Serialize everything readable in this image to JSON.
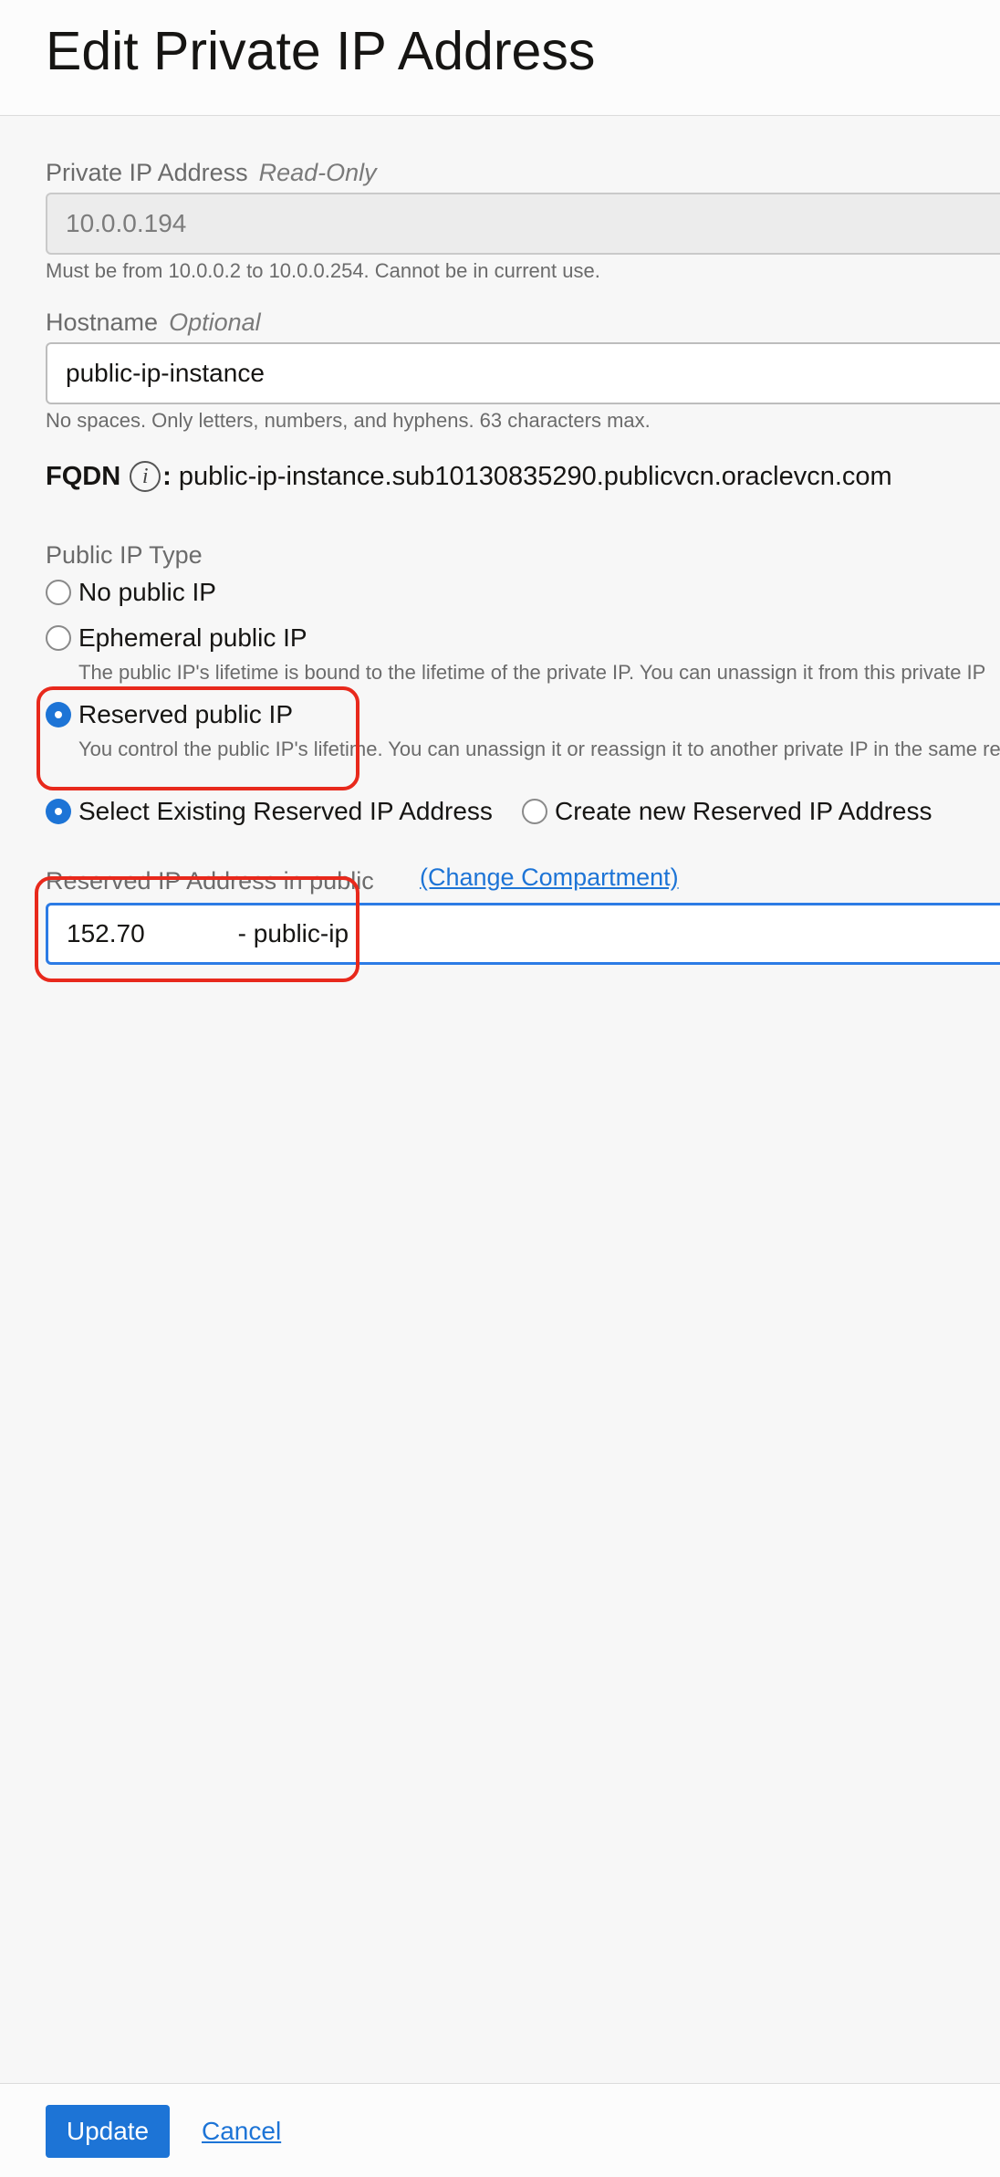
{
  "header": {
    "title": "Edit Private IP Address"
  },
  "private_ip": {
    "label": "Private IP Address",
    "qualifier": "Read-Only",
    "value": "10.0.0.194",
    "help": "Must be from 10.0.0.2 to 10.0.0.254. Cannot be in current use."
  },
  "hostname": {
    "label": "Hostname",
    "qualifier": "Optional",
    "value": "public-ip-instance",
    "help": "No spaces. Only letters, numbers, and hyphens. 63 characters max."
  },
  "fqdn": {
    "label": "FQDN",
    "info_icon": "i",
    "colon": ":",
    "value": "public-ip-instance.sub10130835290.publicvcn.oraclevcn.com"
  },
  "public_ip_type": {
    "label": "Public IP Type",
    "options": [
      {
        "label": "No public IP",
        "checked": false
      },
      {
        "label": "Ephemeral public IP",
        "checked": false,
        "description": "The public IP's lifetime is bound to the lifetime of the private IP. You can unassign it from this private IP"
      },
      {
        "label": "Reserved public IP",
        "checked": true,
        "description": "You control the public IP's lifetime. You can unassign it or reassign it to another private IP in the same re"
      }
    ]
  },
  "reserved_source": {
    "options": [
      {
        "label": "Select Existing Reserved IP Address",
        "checked": true
      },
      {
        "label": "Create new Reserved IP Address",
        "checked": false
      }
    ]
  },
  "reserved_ip": {
    "label": "Reserved IP Address in public",
    "change_link": "(Change Compartment)",
    "value_ip": "152.70",
    "value_name": "- public-ip"
  },
  "footer": {
    "update_label": "Update",
    "cancel_label": "Cancel"
  },
  "colors": {
    "accent": "#1d74d6",
    "highlight": "#e8291c",
    "background": "#f7f7f7"
  }
}
